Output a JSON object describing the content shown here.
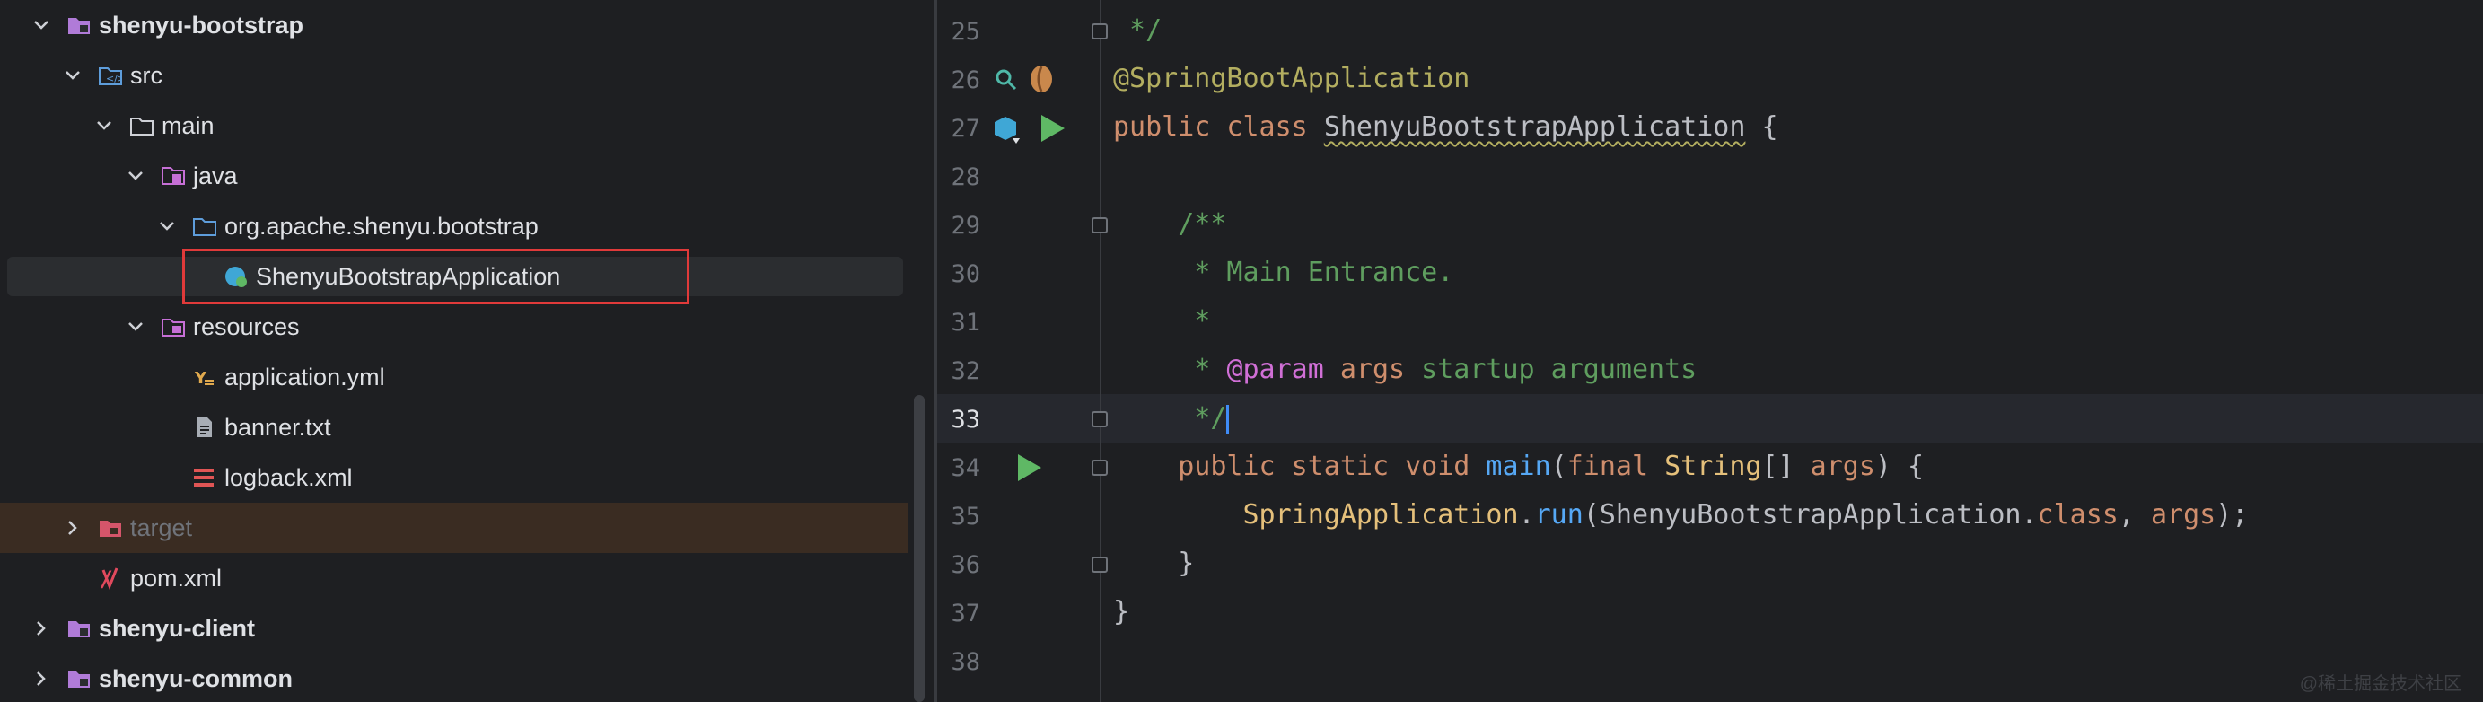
{
  "project_tree": {
    "items": [
      {
        "label": "shenyu-bootstrap",
        "depth": 0,
        "chevron": "down",
        "icon": "module-folder-icon",
        "bold": true
      },
      {
        "label": "src",
        "depth": 1,
        "chevron": "down",
        "icon": "source-folder-icon"
      },
      {
        "label": "main",
        "depth": 2,
        "chevron": "down",
        "icon": "folder-icon"
      },
      {
        "label": "java",
        "depth": 3,
        "chevron": "down",
        "icon": "java-source-root-icon"
      },
      {
        "label": "org.apache.shenyu.bootstrap",
        "depth": 4,
        "chevron": "down",
        "icon": "package-icon"
      },
      {
        "label": "ShenyuBootstrapApplication",
        "depth": 5,
        "chevron": "",
        "icon": "spring-boot-class-icon",
        "selected": true
      },
      {
        "label": "resources",
        "depth": 3,
        "chevron": "down",
        "icon": "resources-folder-icon"
      },
      {
        "label": "application.yml",
        "depth": 4,
        "chevron": "",
        "icon": "yaml-file-icon"
      },
      {
        "label": "banner.txt",
        "depth": 4,
        "chevron": "",
        "icon": "text-file-icon"
      },
      {
        "label": "logback.xml",
        "depth": 4,
        "chevron": "",
        "icon": "xml-file-icon"
      },
      {
        "label": "target",
        "depth": 1,
        "chevron": "right",
        "icon": "excluded-folder-icon",
        "dim": true
      },
      {
        "label": "pom.xml",
        "depth": 1,
        "chevron": "",
        "icon": "maven-icon"
      },
      {
        "label": "shenyu-client",
        "depth": 0,
        "chevron": "right",
        "icon": "module-folder-icon",
        "bold": true
      },
      {
        "label": "shenyu-common",
        "depth": 0,
        "chevron": "right",
        "icon": "module-folder-icon",
        "bold": true
      }
    ]
  },
  "editor": {
    "current_line": "33",
    "line_numbers": [
      "25",
      "26",
      "27",
      "28",
      "29",
      "30",
      "31",
      "32",
      "33",
      "34",
      "35",
      "36",
      "37",
      "38"
    ],
    "code": {
      "l25": " */",
      "l26": "@SpringBootApplication",
      "l27_kw": "public class ",
      "l27_cls": "ShenyuBootstrapApplication",
      "l27_end": " {",
      "l29": "    /**",
      "l30": "     * Main Entrance.",
      "l31": "     *",
      "l32_a": "     * ",
      "l32_tag": "@param",
      "l32_arg": " args",
      "l32_rest": " startup arguments",
      "l33": "     */",
      "l34_kw": "    public static void ",
      "l34_fn": "main",
      "l34_p1": "(",
      "l34_kw2": "final ",
      "l34_type": "String",
      "l34_br": "[] ",
      "l34_arg": "args",
      "l34_end": ") {",
      "l35_a": "        ",
      "l35_cls": "SpringApplication",
      "l35_dot": ".",
      "l35_fn": "run",
      "l35_p": "(",
      "l35_cls2": "ShenyuBootstrapApplication",
      "l35_dot2": ".",
      "l35_kw": "class",
      "l35_comma": ", ",
      "l35_arg": "args",
      "l35_end": ");",
      "l36": "    }",
      "l37": "}"
    }
  },
  "watermark": "@稀土掘金技术社区",
  "colors": {
    "accent": "#3f8cf8",
    "highlight_box": "#e03a3a",
    "run_icon": "#5fb865"
  }
}
